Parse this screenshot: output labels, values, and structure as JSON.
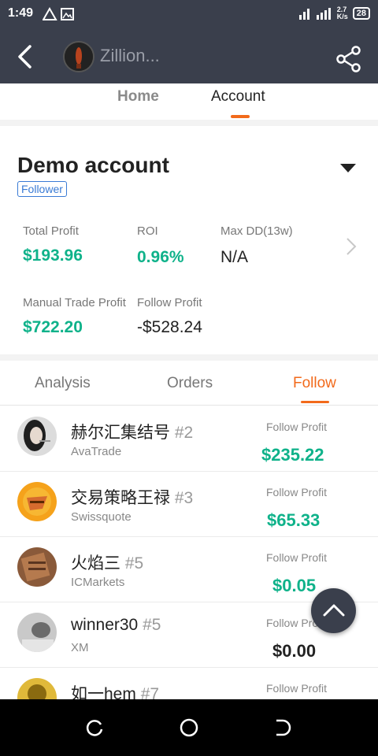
{
  "status": {
    "time": "1:49",
    "net_speed_value": "2.7",
    "net_speed_unit": "K/s",
    "battery": "28"
  },
  "header": {
    "title": "Zillion..."
  },
  "top_tabs": [
    {
      "label": "Home"
    },
    {
      "label": "Account"
    }
  ],
  "account": {
    "name": "Demo account",
    "badge": "Follower",
    "stats": [
      {
        "label": "Total Profit",
        "value": "$193.96"
      },
      {
        "label": "ROI",
        "value": "0.96%"
      },
      {
        "label": "Max DD(13w)",
        "value": "N/A"
      },
      {
        "label": "Manual Trade Profit",
        "value": "$722.20"
      },
      {
        "label": "Follow Profit",
        "value": "-$528.24"
      }
    ]
  },
  "sub_tabs": [
    {
      "label": "Analysis"
    },
    {
      "label": "Orders"
    },
    {
      "label": "Follow"
    }
  ],
  "follow_list": [
    {
      "name": "赫尔汇集结号",
      "rank": "#2",
      "broker": "AvaTrade",
      "profit_label": "Follow Profit",
      "profit": "$235.22"
    },
    {
      "name": "交易策略王禄",
      "rank": "#3",
      "broker": "Swissquote",
      "profit_label": "Follow Profit",
      "profit": "$65.33"
    },
    {
      "name": "火焰三",
      "rank": "#5",
      "broker": "ICMarkets",
      "profit_label": "Follow Profit",
      "profit": "$0.05"
    },
    {
      "name": "winner30",
      "rank": "#5",
      "broker": "XM",
      "profit_label": "Follow Profit",
      "profit": "$0.00"
    },
    {
      "name": "如一hem",
      "rank": "#7",
      "broker": "",
      "profit_label": "Follow Profit",
      "profit": ""
    }
  ],
  "colors": {
    "accent": "#f26a1b",
    "positive": "#0fb28a",
    "header_bg": "#3a3f4c"
  }
}
